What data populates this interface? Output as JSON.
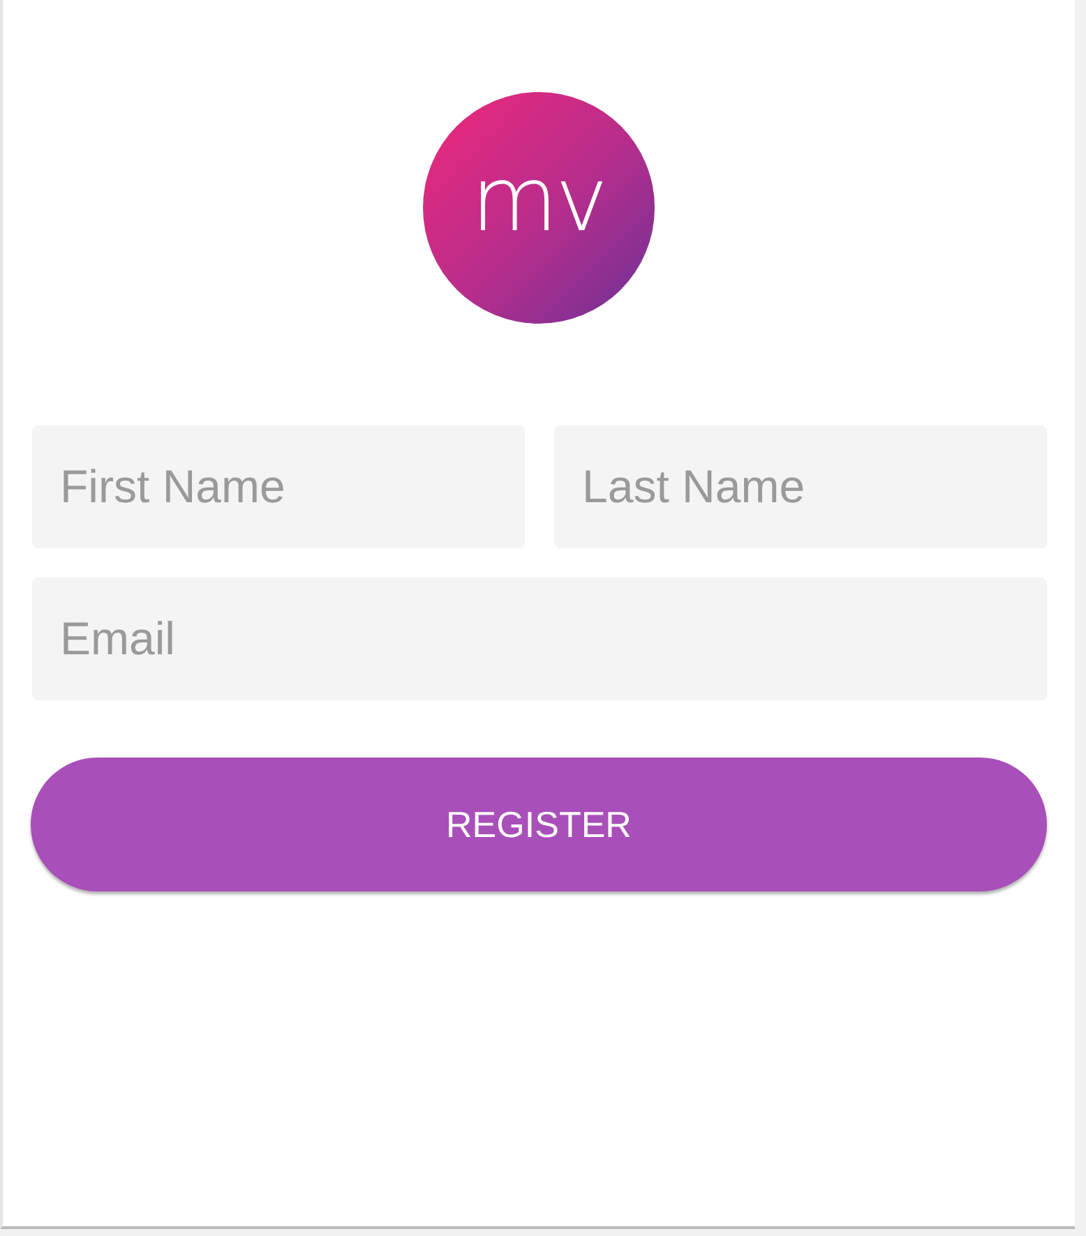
{
  "logo": {
    "text": "mv"
  },
  "fields": [
    {
      "placeholder": "First Name"
    },
    {
      "placeholder": "Last Name"
    },
    {
      "placeholder": "Email"
    }
  ],
  "button": {
    "label": "REGISTER"
  }
}
